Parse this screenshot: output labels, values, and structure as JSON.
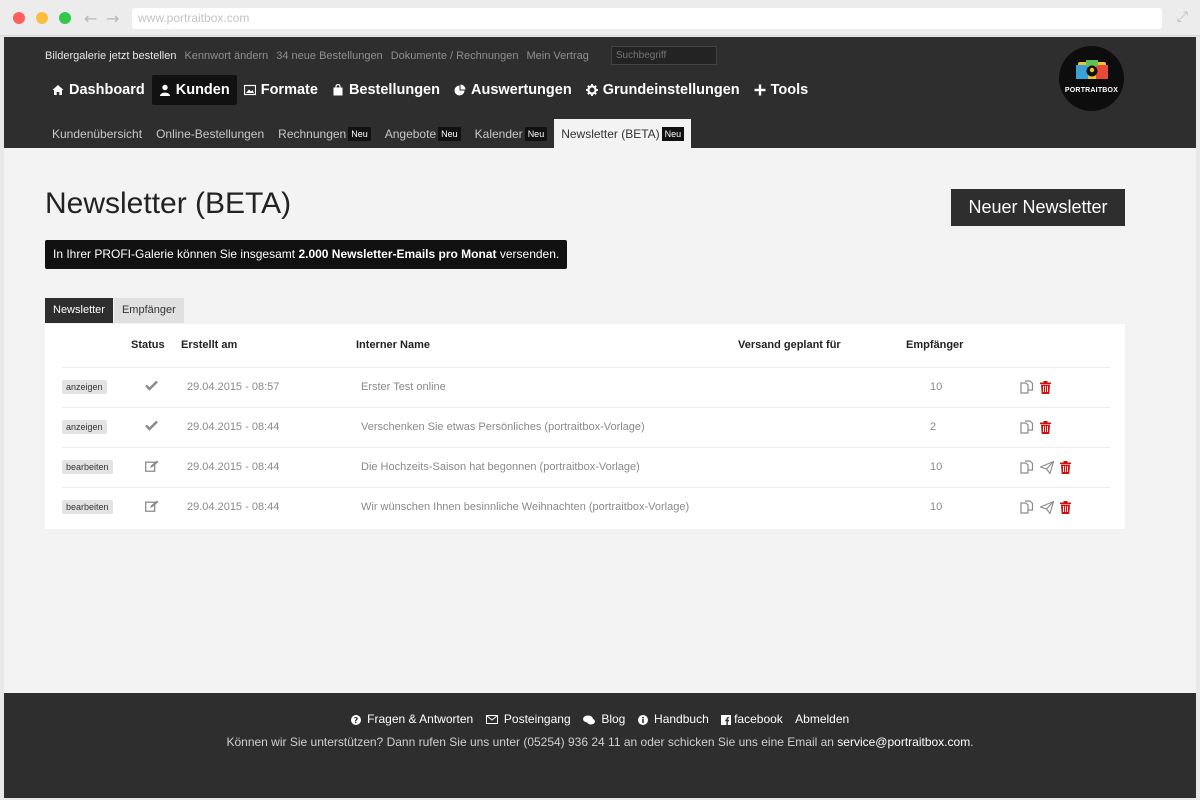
{
  "browser": {
    "url": "www.portraitbox.com"
  },
  "utility_nav": {
    "items": [
      "Bildergalerie jetzt bestellen",
      "Kennwort ändern",
      "34 neue Bestellungen",
      "Dokumente / Rechnungen",
      "Mein Vertrag"
    ],
    "search_placeholder": "Suchbegriff"
  },
  "main_nav": [
    "Dashboard",
    "Kunden",
    "Formate",
    "Bestellungen",
    "Auswertungen",
    "Grundeinstellungen",
    "Tools"
  ],
  "logo": {
    "text": "PORTRAITBOX",
    "accent": "#e33333"
  },
  "sub_nav": [
    {
      "label": "Kundenübersicht",
      "badge": ""
    },
    {
      "label": "Online-Bestellungen",
      "badge": ""
    },
    {
      "label": "Rechnungen",
      "badge": "Neu"
    },
    {
      "label": "Angebote",
      "badge": "Neu"
    },
    {
      "label": "Kalender",
      "badge": "Neu"
    },
    {
      "label": "Newsletter (BETA)",
      "badge": "Neu"
    }
  ],
  "page": {
    "title": "Newsletter (BETA)",
    "new_button": "Neuer Newsletter",
    "info_pre": "In Ihrer PROFI-Galerie können Sie insgesamt ",
    "info_bold": "2.000 Newsletter-Emails pro Monat",
    "info_post": " versenden."
  },
  "tabs": [
    "Newsletter",
    "Empfänger"
  ],
  "table": {
    "headers": [
      "",
      "Status",
      "Erstellt am",
      "Interner Name",
      "Versand geplant für",
      "Empfänger",
      ""
    ],
    "rows": [
      {
        "action": "anzeigen",
        "status": "check-icon",
        "created": "29.04.2015 - 08:57",
        "name": "Erster Test online",
        "scheduled": "",
        "recipients": "10",
        "send": false
      },
      {
        "action": "anzeigen",
        "status": "check-icon",
        "created": "29.04.2015 - 08:44",
        "name": "Verschenken Sie etwas Persönliches (portraitbox-Vorlage)",
        "scheduled": "",
        "recipients": "2",
        "send": false
      },
      {
        "action": "bearbeiten",
        "status": "edit-icon",
        "created": "29.04.2015 - 08:44",
        "name": "Die Hochzeits-Saison hat begonnen (portraitbox-Vorlage)",
        "scheduled": "",
        "recipients": "10",
        "send": true
      },
      {
        "action": "bearbeiten",
        "status": "edit-icon",
        "created": "29.04.2015 - 08:44",
        "name": "Wir wünschen Ihnen besinnliche Weihnachten (portraitbox-Vorlage)",
        "scheduled": "",
        "recipients": "10",
        "send": true
      }
    ]
  },
  "footer": {
    "links": [
      "Fragen & Antworten",
      "Posteingang",
      "Blog",
      "Handbuch",
      "facebook",
      "Abmelden"
    ],
    "text_pre": "Können wir Sie unterstützen? Dann rufen Sie uns unter (05254) 936 24 11 an oder schicken Sie uns eine Email an ",
    "email": "service@portraitbox.com",
    "text_post": "."
  },
  "colors": {
    "header": "#2e2e2e",
    "delete": "#cc1111"
  }
}
